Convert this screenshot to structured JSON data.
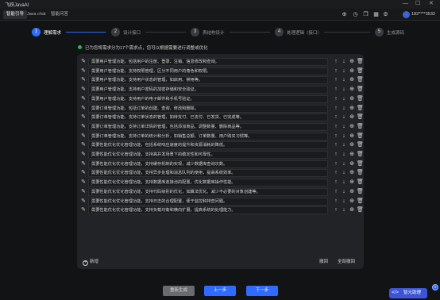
{
  "window": {
    "title": "飞跃JavaAI",
    "controls": [
      "—",
      "☐",
      "✕"
    ]
  },
  "tabs": [
    {
      "label": "智能引导",
      "active": true
    },
    {
      "label": "Java chat",
      "active": false
    },
    {
      "label": "智能问答",
      "active": false
    }
  ],
  "toolbar_icons": [
    "add-circle-icon",
    "history-icon",
    "copy-icon",
    "layout-icon",
    "gear-icon"
  ],
  "user": {
    "phone": "182****3532"
  },
  "steps": [
    {
      "number": "1",
      "label": "理解需求",
      "active": true
    },
    {
      "number": "2",
      "label": "设计接口",
      "active": false
    },
    {
      "number": "3",
      "label": "表结构设计",
      "active": false
    },
    {
      "number": "4",
      "label": "处理逻辑（接口）",
      "active": false
    },
    {
      "number": "5",
      "label": "生成源码",
      "active": false
    }
  ],
  "notice": "已为您将需求分为17个需求点，您可以根据需要进行调整或优化",
  "requirements": [
    "需要用户管理功能，包括用户的注册、登录、注销、信息修改和查询。",
    "需要用户管理功能，支持权限管理，区分不同用户的角色和权限。",
    "需要用户管理功能，支持用户状态的管理，如启用、禁用等。",
    "需要用户管理功能，支持用户密码的加密存储和安全验证。",
    "需要用户管理功能，支持用户的电子邮件和手机号验证。",
    "需要订单管理功能，包括订单的创建、查询、修改和删除。",
    "需要订单管理功能，支持订单状态的管理，如待支付、已支付、已发货、已完成等。",
    "需要订单管理功能，支持订单详情的管理，包括添加商品、调整数量、删除商品等。",
    "需要订单管理功能，支持订单的统计和分析，如销售总额、订单数量、用户购买习惯等。",
    "需要性能优化优化管理功能，包括系统响应速度的提升和资源消耗的降低。",
    "需要性能优化优化管理功能，支持高并发场景下的稳定性和可靠性。",
    "需要性能优化优化管理功能，支持缓存机制的实现，减少数据库查询次数。",
    "需要性能优化优化管理功能，支持异步处理和消息队列的使用，提高系统效率。",
    "需要性能优化优化管理功能，支持数据库连接池的配置，优化数据库操作性能。",
    "需要性能优化优化管理功能，支持代码级别的优化，如算法优化、减少不必要的对象创建等。",
    "需要性能优化优化管理功能，支持日志的合理配置，便于监控和排查问题。",
    "需要性能优化优化管理功能，支持负载均衡和横向扩展，提高系统的处理能力。"
  ],
  "row_actions": [
    "arrow-up-icon",
    "arrow-down-icon",
    "add-circle-icon",
    "trash-icon"
  ],
  "panel_footer": {
    "add_label": "新增",
    "undo_label": "撤回",
    "undo_all_label": "全部撤回"
  },
  "buttons": {
    "regenerate": "重新生成",
    "prev": "上一步",
    "next": "下一步"
  },
  "float": {
    "label": "智元助理",
    "badge": "1"
  },
  "colors": {
    "accent": "#2f6bff",
    "success": "#28b463",
    "background": "#121314",
    "panel": "#222326"
  }
}
